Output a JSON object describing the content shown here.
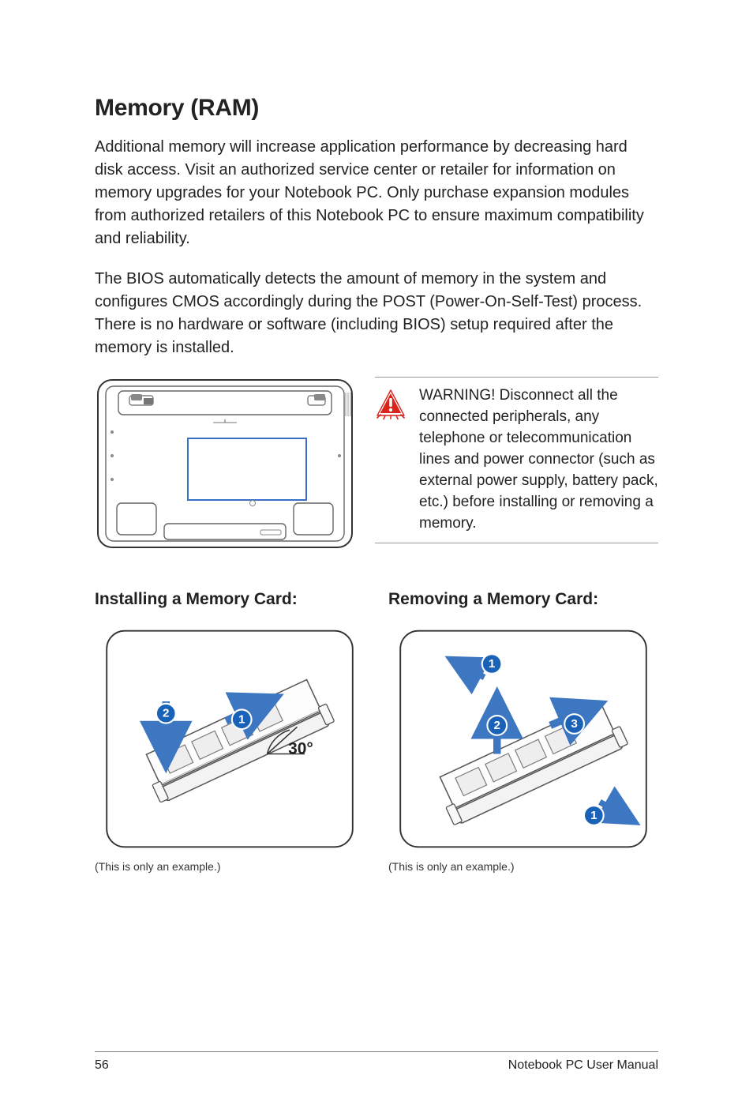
{
  "title": "Memory (RAM)",
  "para1": "Additional memory will increase application performance by decreasing hard disk access. Visit an authorized service center or retailer for information on memory upgrades for your Notebook PC. Only purchase expansion modules from authorized retailers of this Notebook PC to ensure maximum compatibility and reliability.",
  "para2": "The BIOS automatically detects the amount of memory in the system and configures CMOS accordingly during the POST (Power-On-Self-Test) process. There is no hardware or software (including BIOS) setup required after the memory is installed.",
  "warning_text": "WARNING! Disconnect all the connected peripherals, any telephone or telecommunication lines and power connector (such as external power supply, battery pack, etc.) before installing or removing a memory.",
  "install_heading": "Installing a Memory Card:",
  "remove_heading": "Removing a Memory Card:",
  "angle_label": "30",
  "angle_degree_symbol": "°",
  "example_caption": "(This is only an example.)",
  "footer_page_number": "56",
  "footer_manual_title": "Notebook PC User Manual",
  "colors": {
    "warning_red": "#d9241c",
    "arrow_blue": "#3d77c2",
    "badge_blue": "#1a62b7",
    "slot_blue": "#3b6fc7"
  }
}
